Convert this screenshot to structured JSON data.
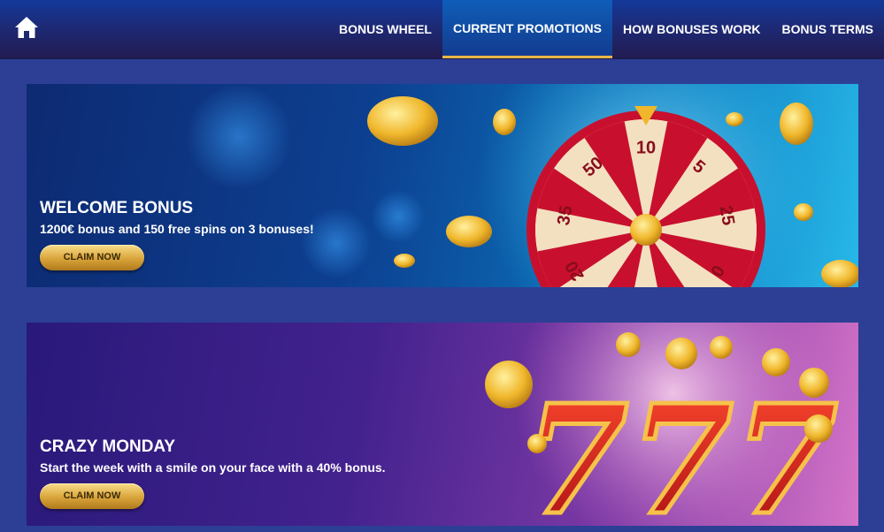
{
  "header": {
    "home_icon": "home-icon",
    "nav": [
      {
        "label": "BONUS WHEEL",
        "active": false
      },
      {
        "label": "CURRENT PROMOTIONS",
        "active": true
      },
      {
        "label": "HOW BONUSES WORK",
        "active": false
      },
      {
        "label": "BONUS TERMS",
        "active": false
      }
    ],
    "colors": {
      "active_underline": "#e8b64a",
      "page_bg": "#2c3f95"
    }
  },
  "promotions": [
    {
      "title": "WELCOME BONUS",
      "description": "1200€ bonus and 150 free spins on 3 bonuses!",
      "button": "CLAIM NOW",
      "wheel_numbers": [
        "10",
        "5",
        "25",
        "0",
        "50",
        "5",
        "20",
        "35",
        "50"
      ]
    },
    {
      "title": "CRAZY MONDAY",
      "description": "Start the week with a smile on your face with a 40% bonus.",
      "button": "CLAIM NOW",
      "slot_symbol": "777"
    }
  ]
}
